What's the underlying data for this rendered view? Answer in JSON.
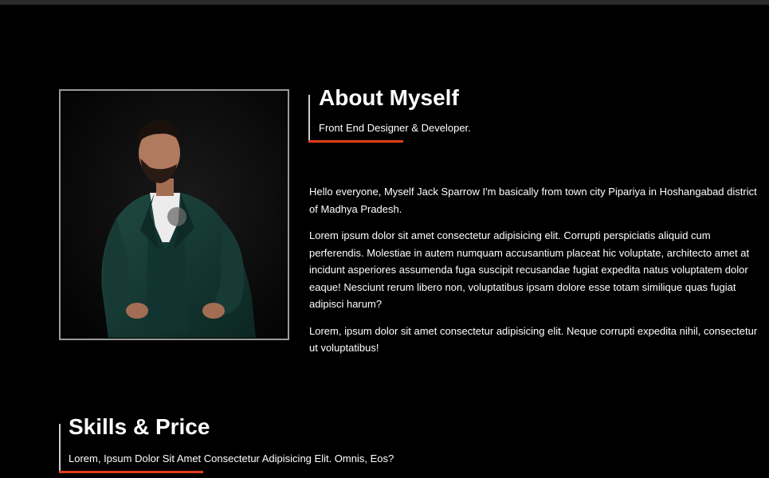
{
  "about": {
    "title": "About Myself",
    "subtitle": "Front End Designer & Developer.",
    "paragraphs": [
      "Hello everyone, Myself Jack Sparrow I'm basically from town city Pipariya in Hoshangabad district of Madhya Pradesh.",
      "Lorem ipsum dolor sit amet consectetur adipisicing elit. Corrupti perspiciatis aliquid cum perferendis. Molestiae in autem numquam accusantium placeat hic voluptate, architecto amet at incidunt asperiores assumenda fuga suscipit recusandae fugiat expedita natus voluptatem dolor eaque! Nesciunt rerum libero non, voluptatibus ipsam dolore esse totam similique quas fugiat adipisci harum?",
      "Lorem, ipsum dolor sit amet consectetur adipisicing elit. Neque corrupti expedita nihil, consectetur ut voluptatibus!"
    ]
  },
  "skills": {
    "title": "Skills & Price",
    "subtitle": "Lorem, Ipsum Dolor Sit Amet Consectetur Adipisicing Elit. Omnis, Eos?"
  },
  "colors": {
    "background": "#000000",
    "accent": "#e0401a",
    "frame": "#9a9a9a",
    "text": "#ffffff"
  }
}
